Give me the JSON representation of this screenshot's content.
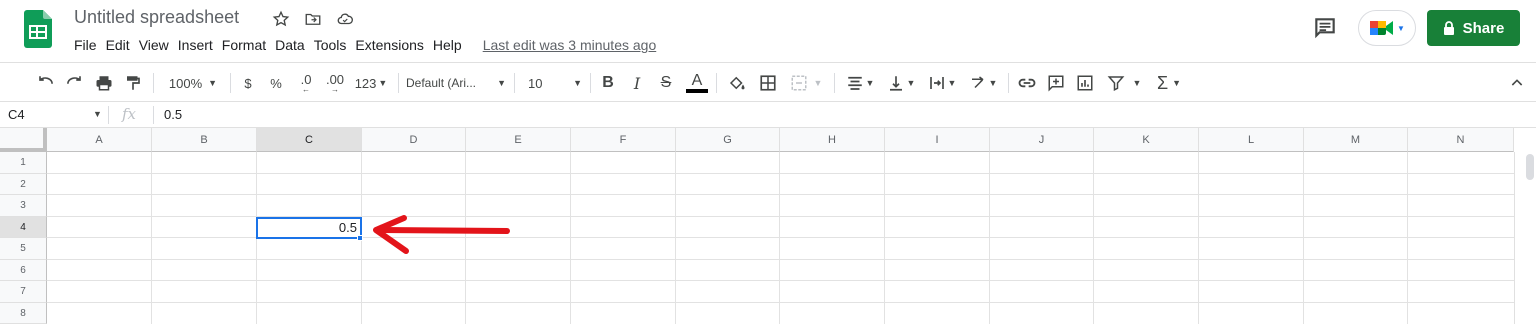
{
  "doc": {
    "title": "Untitled spreadsheet"
  },
  "menu": [
    "File",
    "Edit",
    "View",
    "Insert",
    "Format",
    "Data",
    "Tools",
    "Extensions",
    "Help"
  ],
  "last_edit": "Last edit was 3 minutes ago",
  "share_label": "Share",
  "toolbar": {
    "zoom": "100%",
    "currency": "$",
    "percent": "%",
    "dec_decrease": ".0",
    "dec_increase": ".00",
    "more_formats": "123",
    "font": "Default (Ari...",
    "font_size": "10"
  },
  "formula_bar": {
    "name_box": "C4",
    "fx": "fx",
    "value": "0.5"
  },
  "columns": [
    "A",
    "B",
    "C",
    "D",
    "E",
    "F",
    "G",
    "H",
    "I",
    "J",
    "K",
    "L",
    "M",
    "N"
  ],
  "rows": [
    "1",
    "2",
    "3",
    "4",
    "5",
    "6",
    "7",
    "8"
  ],
  "active_cell": {
    "ref": "C4",
    "value": "0.5"
  },
  "colors": {
    "accent": "#1a73e8",
    "share": "#188038",
    "arrow": "#e3141a",
    "sheets_green": "#0f9d58"
  }
}
